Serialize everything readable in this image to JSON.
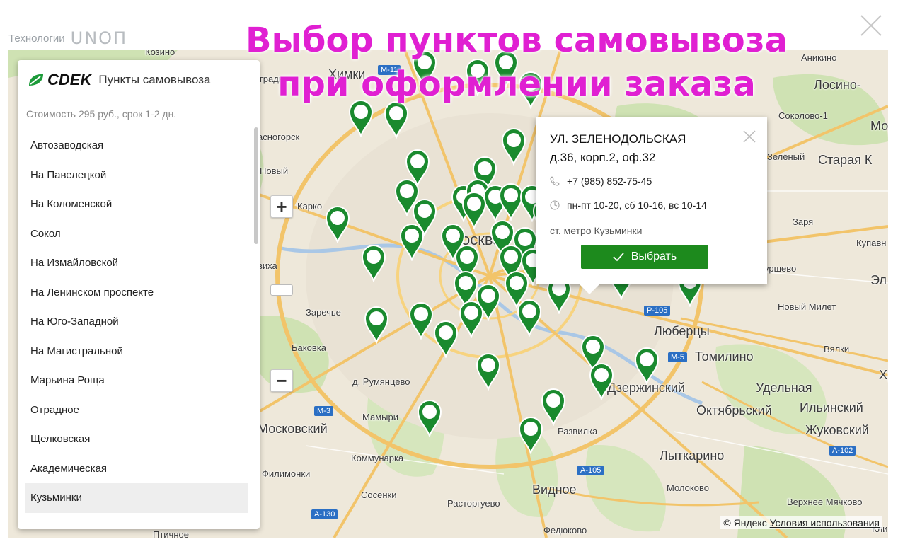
{
  "header": {
    "brand_label": "Технологии",
    "brand_logo": "UNOП",
    "headline_line1": "Выбор пунктов самовывоза",
    "headline_line2": "при оформлении заказа"
  },
  "panel": {
    "logo_text": "CDEK",
    "title": "Пункты самовывоза",
    "cost": "Стоимость 295 руб., срок 1-2 дн.",
    "items": [
      {
        "label": "Автозаводская"
      },
      {
        "label": "На Павелецкой"
      },
      {
        "label": "На Коломенской"
      },
      {
        "label": "Сокол"
      },
      {
        "label": "На Измайловской"
      },
      {
        "label": "На Ленинском проспекте"
      },
      {
        "label": "На Юго-Западной"
      },
      {
        "label": "На Магистральной"
      },
      {
        "label": "Марьина Роща"
      },
      {
        "label": "Отрадное"
      },
      {
        "label": "Щелковская"
      },
      {
        "label": "Академическая"
      },
      {
        "label": "Кузьминки"
      }
    ],
    "selected": "Кузьминки"
  },
  "popup": {
    "address_line1": "УЛ. ЗЕЛЕНОДОЛЬСКАЯ",
    "address_line2": "д.36, корп.2, оф.32",
    "phone": "+7 (985) 852-75-45",
    "hours": "пн-пт 10-20, сб 10-16, вс 10-14",
    "metro": "ст. метро Кузьминки",
    "select_button": "Выбрать"
  },
  "map": {
    "labels": {
      "khimki": "Химки",
      "kozino": "Козино",
      "anikino": "Аникино",
      "losino": "Лосино-",
      "sokolovo": "Соколово-1",
      "mo": "Мо",
      "zeleny": "Зелёный",
      "staraya": "Старая К",
      "zarya": "Заря",
      "kupavna": "Купавн",
      "urshevo": "уршево",
      "el": "Эл",
      "noviy_milet": "Новый Милет",
      "lyubertsy": "Люберцы",
      "tomilino": "Томилино",
      "vyalki": "Вялки",
      "dzerzhinsky": "Дзержинский",
      "udelnaya": "Удельная",
      "oktyabrsky": "Октябрьский",
      "ilinsky": "Ильинский",
      "zhukovsky": "Жуковский",
      "lytkarino": "Лыткарино",
      "molokovo": "Молоково",
      "verkhnee": "Верхнее Мячково",
      "vidnoe": "Видное",
      "fedyukovo": "Федюково",
      "rastorguevo": "Расторгуево",
      "razvilka": "Развилка",
      "kommunarka": "Коммунарка",
      "sosenki": "Сосенки",
      "filimonki": "Филимонки",
      "mamyri": "Мамыри",
      "moskovsky": "Московский",
      "rumyantsevo": "д. Румянцево",
      "bakovka": "Баковка",
      "zarechye": "Заречье",
      "krasnogorsk": "асногорск",
      "noviy": "Новый",
      "karko": "Карко",
      "moskva": "осква",
      "viha": "виха",
      "gradnoe": "градное",
      "pitchnoe": "Птичное",
      "kli": "Кли",
      "hr": "Хр"
    },
    "road_shields": {
      "m11": "M-11",
      "r105": "P-105",
      "m5": "M-5",
      "m3": "M-3",
      "a105": "A-105",
      "a102": "A-102",
      "a130": "A-130"
    },
    "pin_color": "#1a8a2e"
  },
  "attribution": {
    "yandex": "© Яндекс",
    "terms": "Условия использования"
  }
}
